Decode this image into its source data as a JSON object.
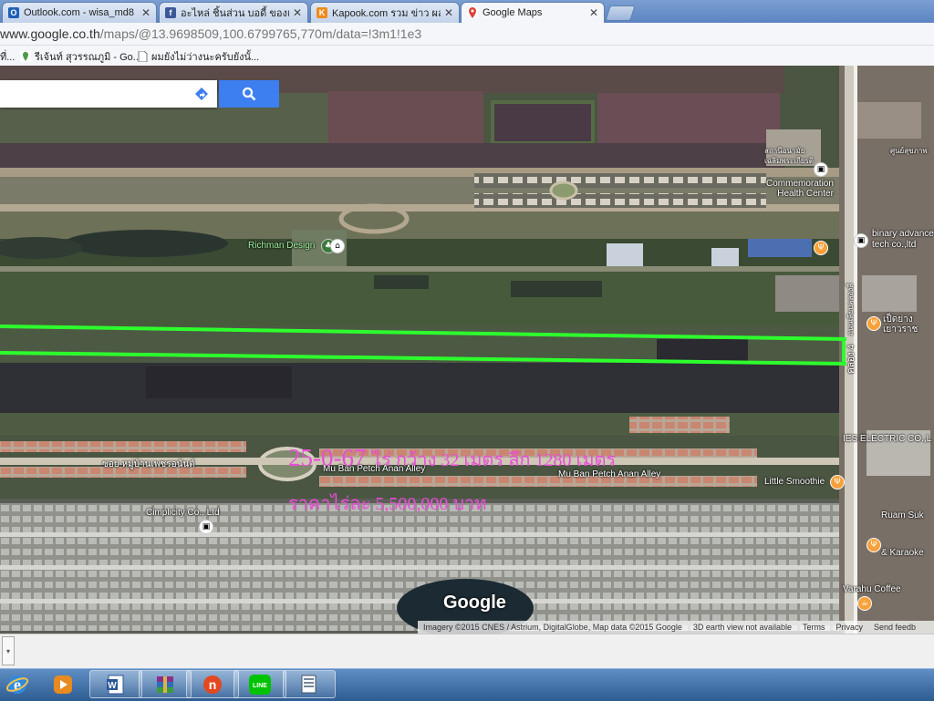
{
  "browser": {
    "tabs": [
      {
        "title": "Outlook.com - wisa_md8",
        "favicon": "outlook-icon",
        "color": "#1f5fb6"
      },
      {
        "title": "อะไหล่ ชิ้นส่วน บอดี้ ของแต่ง",
        "favicon": "facebook-icon",
        "color": "#3b5998"
      },
      {
        "title": "Kapook.com รวม ข่าว ผลบอ",
        "favicon": "kapook-icon",
        "color": "#f08a1c"
      },
      {
        "title": "Google Maps",
        "favicon": "maps-icon",
        "color": "#4a9d4a"
      }
    ],
    "url_prefix": "www.google.co.th",
    "url_path": "/maps/@13.9698509,100.6799765,770m/data=!3m1!1e3",
    "bookmarks": [
      {
        "label": "ที่...",
        "icon": "page-icon"
      },
      {
        "label": "รีเจ้นท์ สุวรรณภูมิ - Go...",
        "icon": "maps-icon"
      },
      {
        "label": "ผมยังไม่ว่างนะครับยังนั้...",
        "icon": "page-icon"
      }
    ]
  },
  "map": {
    "labels": {
      "richman": "Richman Design",
      "commemoration": "Commemoration\nHealth Center",
      "binary": "binary advance\ntech co.,ltd",
      "ies": "IES ELECTRIC CO.,L",
      "little_smoothie": "Little Smoothie",
      "cimplicity": "Cimplicity Co., Ltd",
      "mu_ban_1": "Mu Ban Petch Anan Alley",
      "mu_ban_2": "Mu Ban Petch Anan Alley",
      "soi_thai": "ซอย หมู่บ้านเพชรอนันต์",
      "ruam": "Ruam Suk",
      "karaoke": "& Karaoke",
      "varahu": "Varahu Coffee",
      "khlong4": "คลอง 4",
      "road_vertical": "ถนนเลียบคลองสี่",
      "thai_health": "สถานีอนามัย\nเฉลิมพระเกียรติ",
      "thai_label_1": "ศูนย์สุขภาพ",
      "thai_label_2": "เป็ดย่าง\nเยาวราช"
    },
    "overlay_line1_a": "25-0-67",
    "overlay_line1_b": "ไร่  กว้าง 32 เมตร ลึก 1280 เมตร",
    "overlay_line2": "ราคาไร่ละ 5,500,000 บาท",
    "overlay_color": "#e84dd6",
    "boundary_color": "#2dff2d",
    "google_logo": "Google",
    "attribution": {
      "imagery": "Imagery ©2015 CNES / Astrium, DigitalGlobe, Map data ©2015 Google",
      "earth": "3D earth view not available",
      "terms": "Terms",
      "privacy": "Privacy",
      "feedback": "Send feedb"
    }
  },
  "taskbar": {
    "apps": [
      "ie-icon",
      "media-player-icon",
      "word-icon",
      "winrar-icon",
      "nero-icon",
      "line-icon",
      "explorer-icon"
    ]
  }
}
